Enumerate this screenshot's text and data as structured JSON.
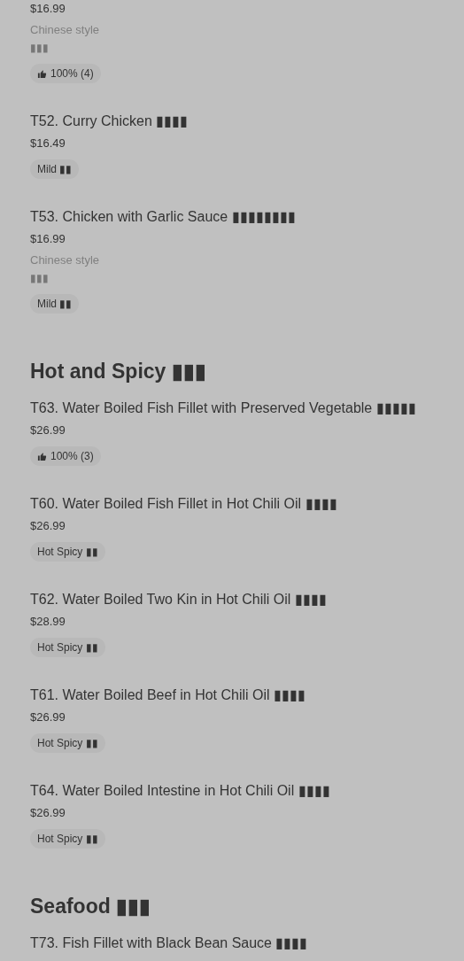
{
  "sections": [
    {
      "items": [
        {
          "price": "$16.99",
          "description": "Chinese style",
          "note": "▮▮▮",
          "tags": [
            {
              "kind": "rating",
              "label": "100% (4)"
            }
          ]
        },
        {
          "name": "T52. Curry Chicken ▮▮▮▮",
          "price": "$16.49",
          "tags": [
            {
              "kind": "label",
              "label": "Mild ▮▮"
            }
          ]
        },
        {
          "name": "T53. Chicken with Garlic Sauce ▮▮▮▮▮▮▮▮",
          "price": "$16.99",
          "description": "Chinese style",
          "note": "▮▮▮",
          "tags": [
            {
              "kind": "label",
              "label": "Mild ▮▮"
            }
          ]
        }
      ]
    },
    {
      "title": "Hot and Spicy ▮▮▮",
      "items": [
        {
          "name": "T63. Water Boiled Fish Fillet with Preserved Vegetable ▮▮▮▮▮",
          "price": "$26.99",
          "tags": [
            {
              "kind": "rating",
              "label": "100% (3)"
            }
          ]
        },
        {
          "name": "T60. Water Boiled Fish Fillet in Hot Chili Oil ▮▮▮▮",
          "price": "$26.99",
          "tags": [
            {
              "kind": "label",
              "label": "Hot Spicy ▮▮"
            }
          ]
        },
        {
          "name": "T62. Water Boiled Two Kin in Hot Chili Oil ▮▮▮▮",
          "price": "$28.99",
          "tags": [
            {
              "kind": "label",
              "label": "Hot Spicy ▮▮"
            }
          ]
        },
        {
          "name": "T61. Water Boiled Beef in Hot Chili Oil ▮▮▮▮",
          "price": "$26.99",
          "tags": [
            {
              "kind": "label",
              "label": "Hot Spicy ▮▮"
            }
          ]
        },
        {
          "name": "T64. Water Boiled Intestine in Hot Chili Oil ▮▮▮▮",
          "price": "$26.99",
          "tags": [
            {
              "kind": "label",
              "label": "Hot Spicy ▮▮"
            }
          ]
        }
      ]
    },
    {
      "title": "Seafood ▮▮▮",
      "items": [
        {
          "name": "T73. Fish Fillet with Black Bean Sauce ▮▮▮▮"
        }
      ]
    }
  ]
}
